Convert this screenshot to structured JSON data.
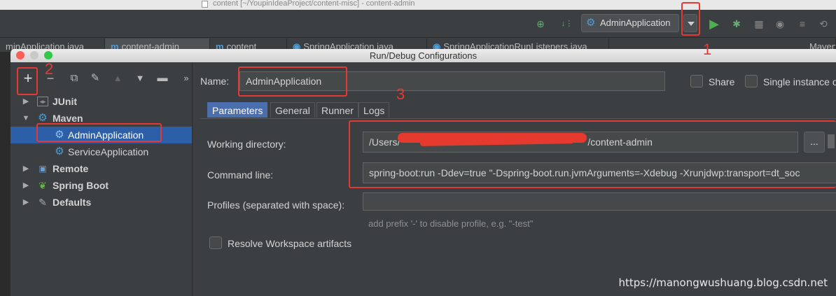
{
  "ide": {
    "window_title": "content [~/YoupinIdeaProject/content-misc] - content-admin",
    "run_config_label": "AdminApplication",
    "editor_tabs": [
      "minApplication.java",
      "content-admin",
      "content",
      "SpringApplication.java",
      "SpringApplicationRunListeners.java",
      "Maven"
    ]
  },
  "dialog": {
    "title": "Run/Debug Configurations",
    "tree": [
      {
        "label": "JUnit"
      },
      {
        "label": "Maven"
      },
      {
        "label": "AdminApplication"
      },
      {
        "label": "ServiceApplication"
      },
      {
        "label": "Remote"
      },
      {
        "label": "Spring Boot"
      },
      {
        "label": "Defaults"
      }
    ],
    "name_label": "Name:",
    "name_value": "AdminApplication",
    "share_label": "Share",
    "single_instance_label": "Single instance o",
    "tabs": [
      "Parameters",
      "General",
      "Runner",
      "Logs"
    ],
    "working_dir_label": "Working directory:",
    "working_dir_prefix": "/Users/",
    "working_dir_suffix": "/content-admin",
    "browse_label": "...",
    "command_line_label": "Command line:",
    "command_line_value": "spring-boot:run -Ddev=true \"-Dspring-boot.run.jvmArguments=-Xdebug -Xrunjdwp:transport=dt_soc",
    "profiles_label": "Profiles (separated with space):",
    "profiles_hint": "add prefix '-' to disable profile, e.g. \"-test\"",
    "resolve_label": "Resolve Workspace artifacts"
  },
  "annotations": {
    "n1": "1",
    "n2": "2",
    "n3": "3"
  },
  "watermark": "https://manongwushuang.blog.csdn.net",
  "colors": {
    "annotation_red": "#e53935",
    "selection": "#2d5ea8",
    "active_tab": "#4b6eaf"
  }
}
